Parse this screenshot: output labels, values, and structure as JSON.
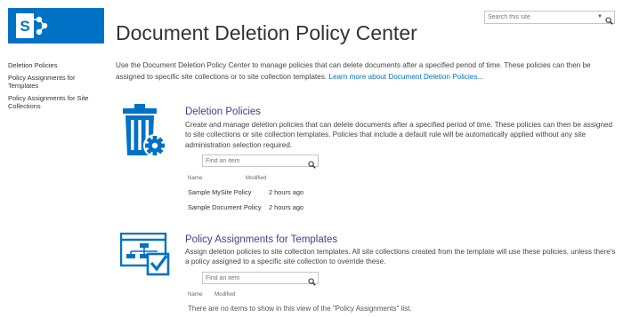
{
  "app": {
    "logo_icon": "sharepoint-logo-icon",
    "brand_color": "#0072c6",
    "title": "Document Deletion Policy Center"
  },
  "search": {
    "placeholder": "Search this site",
    "dropdown_icon": "chevron-down-icon",
    "search_icon": "magnifier-icon"
  },
  "leftnav": {
    "items": [
      {
        "label": "Deletion Policies"
      },
      {
        "label": "Policy Assignments for Templates"
      },
      {
        "label": "Policy Assignments for Site Collections"
      }
    ]
  },
  "intro": {
    "text": "Use the Document Deletion Policy Center to manage policies that can delete documents after a specified period of time. These policies can then be assigned to specific site collections or to site collection templates.",
    "link": "Learn more about Document Deletion Policies..."
  },
  "deletion_policies": {
    "icon": "trash-gear-icon",
    "title": "Deletion Policies",
    "description": "Create and manage deletion policies that can delete documents after a specified period of time. These policies can then be assigned to site collections or site collection templates. Policies that include a default rule will be automatically applied without any site administration selection required.",
    "find_placeholder": "Find an item",
    "columns": {
      "name": "Name",
      "modified": "Modified"
    },
    "rows": [
      {
        "name": "Sample MySite Policy",
        "modified": "2 hours ago"
      },
      {
        "name": "Sample Document Policy",
        "modified": "2 hours ago"
      }
    ]
  },
  "template_assignments": {
    "icon": "template-assignment-icon",
    "title": "Policy Assignments for Templates",
    "description": "Assign deletion policies to site collection templates. All site collections created from the template will use these policies, unless there's a policy assigned to a specific site collection to override these.",
    "find_placeholder": "Find an item",
    "columns": {
      "name": "Name",
      "modified": "Modified"
    },
    "empty_message": "There are no items to show in this view of the \"Policy Assignments\" list."
  },
  "colors": {
    "accent": "#0072c6",
    "section_title": "#4d3a8a",
    "text": "#444444"
  }
}
